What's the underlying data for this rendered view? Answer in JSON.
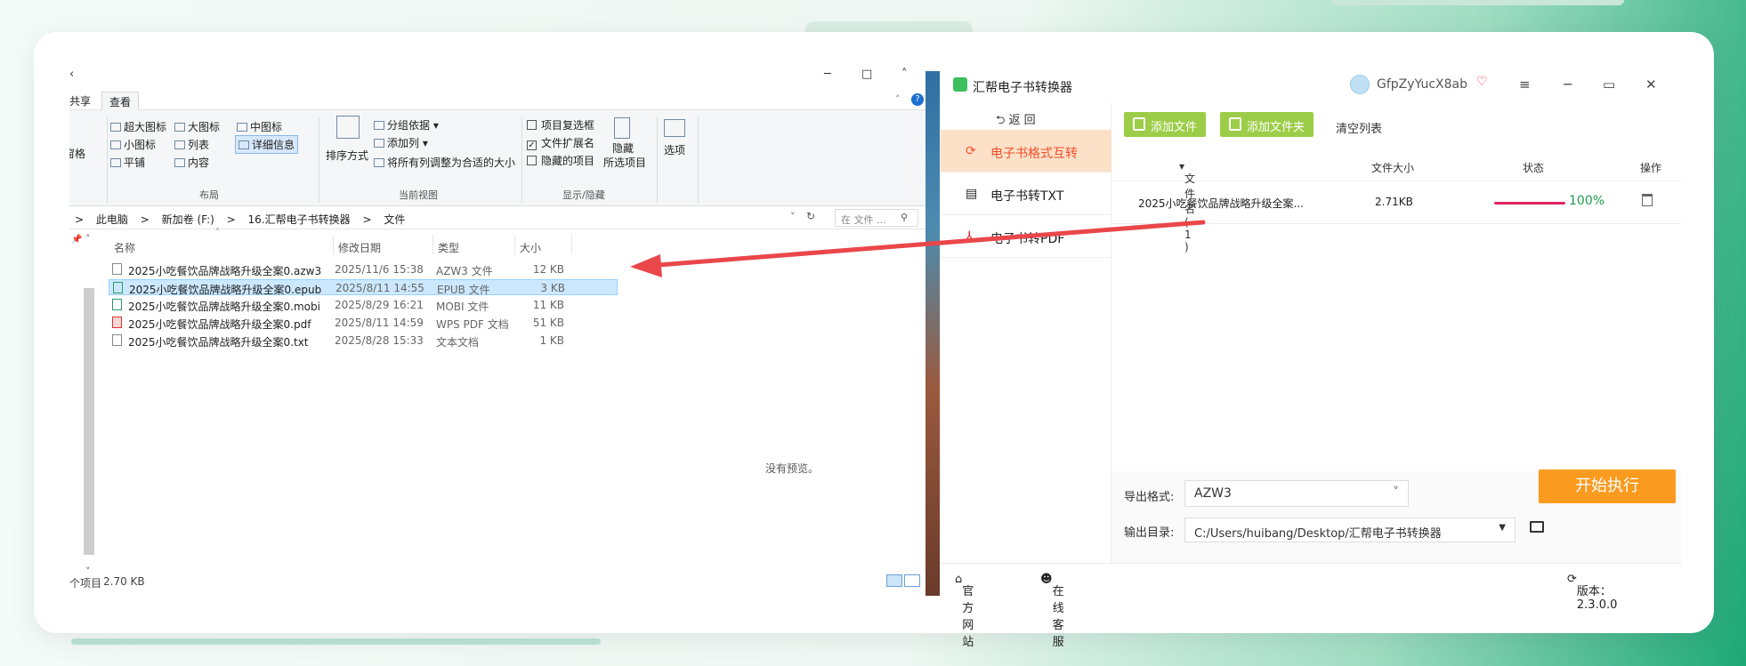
{
  "explorer": {
    "titlebar": {
      "collapse": "˄",
      "minimize": "─",
      "maximize": "□"
    },
    "tabs": [
      "共享",
      "查看"
    ],
    "ribbon": {
      "layout": [
        "超大图标",
        "大图标",
        "中图标",
        "小图标",
        "列表",
        "详细信息",
        "平铺",
        "内容"
      ],
      "pane_label": "窗格",
      "layout_label": "布局",
      "sort_label": "排序方式",
      "group_by": "分组依据",
      "add_column": "添加列",
      "fit_columns": "将所有列调整为合适的大小",
      "current_view_label": "当前视图",
      "item_checkbox": "项目复选框",
      "file_ext": "文件扩展名",
      "hidden_items": "隐藏的项目",
      "hide_selected": "隐藏",
      "hide_selected2": "所选项目",
      "show_hide_label": "显示/隐藏",
      "options": "选项"
    },
    "address": {
      "crumbs": [
        "此电脑",
        "新加卷 (F:)",
        "16.汇帮电子书转换器",
        "文件"
      ],
      "search_placeholder": "在 文件 ...",
      "separator": ">"
    },
    "columns": {
      "name": "名称",
      "date": "修改日期",
      "type": "类型",
      "size": "大小"
    },
    "files": [
      {
        "name": "2025小吃餐饮品牌战略升级全案0.azw3",
        "date": "2025/11/6 15:38",
        "type": "AZW3 文件",
        "size": "12 KB",
        "icon": "file-icon"
      },
      {
        "name": "2025小吃餐饮品牌战略升级全案0.epub",
        "date": "2025/8/11 14:55",
        "type": "EPUB 文件",
        "size": "3 KB",
        "icon": "epub-icon"
      },
      {
        "name": "2025小吃餐饮品牌战略升级全案0.mobi",
        "date": "2025/8/29 16:21",
        "type": "MOBI 文件",
        "size": "11 KB",
        "icon": "mobi-icon"
      },
      {
        "name": "2025小吃餐饮品牌战略升级全案0.pdf",
        "date": "2025/8/11 14:59",
        "type": "WPS PDF 文档",
        "size": "51 KB",
        "icon": "pdf-icon"
      },
      {
        "name": "2025小吃餐饮品牌战略升级全案0.txt",
        "date": "2025/8/28 15:33",
        "type": "文本文档",
        "size": "1 KB",
        "icon": "txt-icon"
      }
    ],
    "no_preview": "没有预览。",
    "status": {
      "items": "个项目",
      "size": "2.70 KB"
    }
  },
  "app": {
    "title": "汇帮电子书转换器",
    "username": "GfpZyYucX8ab",
    "back": "返 回",
    "nav": [
      "电子书格式互转",
      "电子书转TXT",
      "电子书转PDF"
    ],
    "add_file": "添加文件",
    "add_folder": "添加文件夹",
    "clear_list": "清空列表",
    "table": {
      "col_name": "文件名 ( 1 )",
      "col_size": "文件大小",
      "col_status": "状态",
      "col_action": "操作",
      "rows": [
        {
          "name": "2025小吃餐饮品牌战略升级全案...",
          "size": "2.71KB",
          "progress": 1.0,
          "progress_text": "100%"
        }
      ]
    },
    "export_format_label": "导出格式:",
    "export_format_value": "AZW3",
    "output_dir_label": "输出目录:",
    "output_dir_value": "C:/Users/huibang/Desktop/汇帮电子书转换器",
    "start_button": "开始执行",
    "footer": {
      "website": "官方网站",
      "support": "在线客服",
      "version": "版本： 2.3.0.0"
    },
    "colors": {
      "accent": "#f0502a",
      "green": "#9ccd48",
      "start": "#fa9a1e",
      "progress": "#e0245e",
      "percent": "#1f9e4b"
    }
  }
}
